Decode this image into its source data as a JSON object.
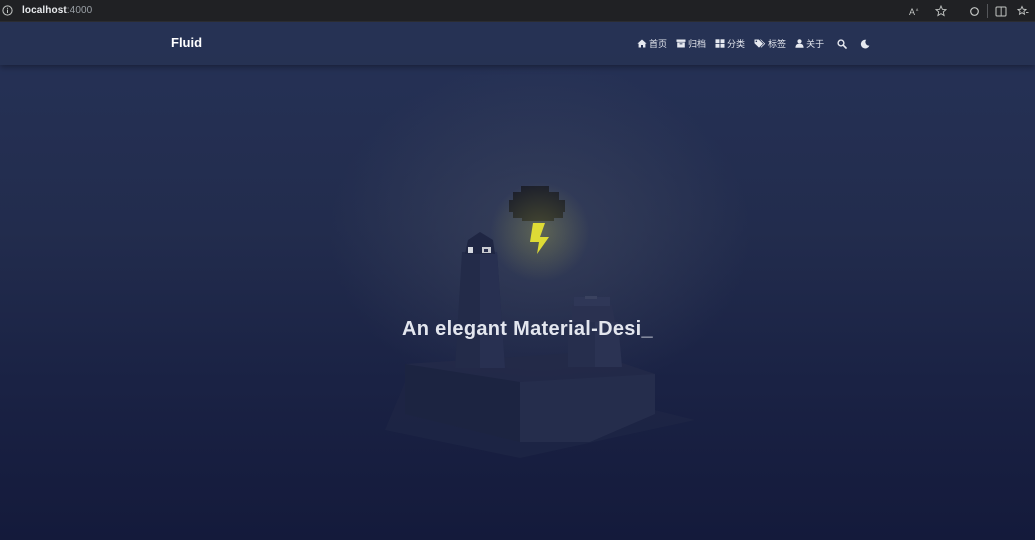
{
  "browser": {
    "url_host": "localhost",
    "url_port": ":4000"
  },
  "navbar": {
    "brand": "Fluid",
    "items": [
      {
        "label": "首页",
        "icon": "home-icon"
      },
      {
        "label": "归档",
        "icon": "archive-icon"
      },
      {
        "label": "分类",
        "icon": "grid-icon"
      },
      {
        "label": "标签",
        "icon": "tags-icon"
      },
      {
        "label": "关于",
        "icon": "user-icon"
      }
    ],
    "search_icon": "search-icon",
    "theme_icon": "moon-icon"
  },
  "hero": {
    "slogan": "An elegant Material-Desi_"
  }
}
